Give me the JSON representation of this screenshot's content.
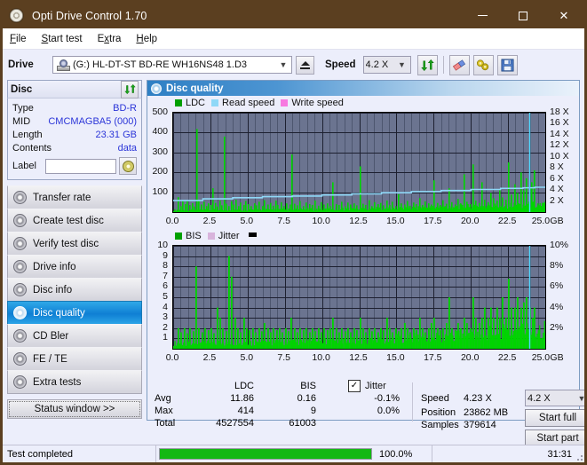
{
  "window": {
    "title": "Opti Drive Control 1.70",
    "icon": "disc-icon",
    "minimize": "─",
    "maximize": "□",
    "close": "✕"
  },
  "menu": {
    "items": [
      {
        "label": "File"
      },
      {
        "label": "Start test"
      },
      {
        "label": "Extra"
      },
      {
        "label": "Help"
      }
    ]
  },
  "toolbar": {
    "drive_label": "Drive",
    "drive_value": "(G:)  HL-DT-ST BD-RE  WH16NS48 1.D3",
    "eject_icon": "eject-icon",
    "speed_label": "Speed",
    "speed_value": "4.2 X",
    "refresh_icon": "refresh-icon",
    "erase_icon": "eraser-icon",
    "tools_icon": "tools-icon",
    "save_icon": "save-icon"
  },
  "disc": {
    "panel_title": "Disc",
    "refresh_icon": "refresh-icon",
    "fields": [
      {
        "key": "Type",
        "value": "BD-R"
      },
      {
        "key": "MID",
        "value": "CMCMAGBA5 (000)"
      },
      {
        "key": "Length",
        "value": "23.31 GB"
      },
      {
        "key": "Contents",
        "value": "data"
      }
    ],
    "label_key": "Label",
    "label_value": "",
    "label_button_icon": "cd-icon"
  },
  "nav": {
    "items": [
      {
        "label": "Transfer rate",
        "selected": false
      },
      {
        "label": "Create test disc",
        "selected": false
      },
      {
        "label": "Verify test disc",
        "selected": false
      },
      {
        "label": "Drive info",
        "selected": false
      },
      {
        "label": "Disc info",
        "selected": false
      },
      {
        "label": "Disc quality",
        "selected": true
      },
      {
        "label": "CD Bler",
        "selected": false
      },
      {
        "label": "FE / TE",
        "selected": false
      },
      {
        "label": "Extra tests",
        "selected": false
      }
    ],
    "status_window": "Status window >>"
  },
  "content": {
    "header_title": "Disc quality",
    "header_icon": "disc-quality-icon"
  },
  "chart_data": [
    {
      "type": "bar",
      "name": "ldc-chart",
      "title": "",
      "xlabel": "GB",
      "ylabel": "LDC",
      "legend": [
        {
          "label": "LDC",
          "color": "#00a000"
        },
        {
          "label": "Read speed",
          "color": "#7ec8f0"
        },
        {
          "label": "Write speed",
          "color": "#f77ae0"
        }
      ],
      "legend_position": "top-left",
      "grid": true,
      "ylim": [
        0,
        500
      ],
      "yticks": [
        100,
        200,
        300,
        400,
        500
      ],
      "y2lim": [
        0,
        18
      ],
      "y2ticks": [
        "2 X",
        "4 X",
        "6 X",
        "8 X",
        "10 X",
        "12 X",
        "14 X",
        "16 X",
        "18 X"
      ],
      "xlim": [
        0,
        25
      ],
      "xticks": [
        "0.0",
        "2.5",
        "5.0",
        "7.5",
        "10.0",
        "12.5",
        "15.0",
        "17.5",
        "20.0",
        "22.5",
        "25.0"
      ],
      "xunit": "GB",
      "bar_color": "#00d400",
      "read_speed_color": "#8fd8f7",
      "spikes": [
        [
          0.28,
          75
        ],
        [
          0.45,
          30
        ],
        [
          0.6,
          55
        ],
        [
          0.75,
          40
        ],
        [
          0.9,
          60
        ],
        [
          1.1,
          35
        ],
        [
          1.25,
          45
        ],
        [
          1.4,
          28
        ],
        [
          1.55,
          418
        ],
        [
          1.7,
          60
        ],
        [
          1.85,
          38
        ],
        [
          2.0,
          52
        ],
        [
          2.2,
          30
        ],
        [
          2.35,
          44
        ],
        [
          2.5,
          36
        ],
        [
          2.65,
          120
        ],
        [
          2.8,
          46
        ],
        [
          2.95,
          28
        ],
        [
          3.1,
          58
        ],
        [
          3.25,
          34
        ],
        [
          3.4,
          380
        ],
        [
          3.55,
          42
        ],
        [
          3.7,
          30
        ],
        [
          3.85,
          55
        ],
        [
          4.0,
          38
        ],
        [
          4.2,
          62
        ],
        [
          4.35,
          30
        ],
        [
          4.5,
          48
        ],
        [
          4.7,
          36
        ],
        [
          4.85,
          56
        ],
        [
          5.0,
          40
        ],
        [
          5.2,
          30
        ],
        [
          5.4,
          44
        ],
        [
          5.55,
          34
        ],
        [
          5.75,
          52
        ],
        [
          5.95,
          30
        ],
        [
          6.1,
          60
        ],
        [
          6.3,
          38
        ],
        [
          6.5,
          46
        ],
        [
          6.7,
          32
        ],
        [
          6.85,
          58
        ],
        [
          7.0,
          36
        ],
        [
          7.2,
          50
        ],
        [
          7.4,
          30
        ],
        [
          7.6,
          44
        ],
        [
          7.8,
          38
        ],
        [
          7.95,
          290
        ],
        [
          8.1,
          42
        ],
        [
          8.3,
          34
        ],
        [
          8.5,
          56
        ],
        [
          8.7,
          30
        ],
        [
          8.9,
          48
        ],
        [
          9.1,
          40
        ],
        [
          9.3,
          36
        ],
        [
          9.5,
          58
        ],
        [
          9.7,
          32
        ],
        [
          9.9,
          50
        ],
        [
          10.1,
          38
        ],
        [
          10.3,
          44
        ],
        [
          10.5,
          30
        ],
        [
          10.7,
          150
        ],
        [
          10.9,
          40
        ],
        [
          11.1,
          36
        ],
        [
          11.3,
          52
        ],
        [
          11.5,
          30
        ],
        [
          11.7,
          48
        ],
        [
          11.9,
          38
        ],
        [
          12.1,
          44
        ],
        [
          12.3,
          34
        ],
        [
          12.5,
          230
        ],
        [
          12.7,
          42
        ],
        [
          12.9,
          36
        ],
        [
          13.1,
          60
        ],
        [
          13.3,
          30
        ],
        [
          13.5,
          50
        ],
        [
          13.7,
          40
        ],
        [
          13.9,
          46
        ],
        [
          14.1,
          34
        ],
        [
          14.3,
          58
        ],
        [
          14.5,
          36
        ],
        [
          14.7,
          52
        ],
        [
          14.9,
          30
        ],
        [
          15.1,
          90
        ],
        [
          15.3,
          44
        ],
        [
          15.5,
          38
        ],
        [
          15.7,
          56
        ],
        [
          15.9,
          32
        ],
        [
          16.1,
          48
        ],
        [
          16.3,
          40
        ],
        [
          16.5,
          70
        ],
        [
          16.7,
          36
        ],
        [
          16.9,
          54
        ],
        [
          17.1,
          44
        ],
        [
          17.3,
          38
        ],
        [
          17.5,
          160
        ],
        [
          17.7,
          46
        ],
        [
          17.9,
          36
        ],
        [
          18.1,
          60
        ],
        [
          18.3,
          42
        ],
        [
          18.5,
          120
        ],
        [
          18.7,
          50
        ],
        [
          18.9,
          38
        ],
        [
          19.1,
          66
        ],
        [
          19.3,
          44
        ],
        [
          19.5,
          190
        ],
        [
          19.7,
          52
        ],
        [
          19.9,
          40
        ],
        [
          20.1,
          240
        ],
        [
          20.3,
          58
        ],
        [
          20.5,
          46
        ],
        [
          20.7,
          150
        ],
        [
          20.9,
          62
        ],
        [
          21.1,
          50
        ],
        [
          21.3,
          96
        ],
        [
          21.5,
          70
        ],
        [
          21.7,
          58
        ],
        [
          21.9,
          110
        ],
        [
          22.1,
          74
        ],
        [
          22.3,
          62
        ],
        [
          22.5,
          250
        ],
        [
          22.7,
          88
        ],
        [
          22.9,
          140
        ],
        [
          23.1,
          96
        ],
        [
          23.3,
          200
        ],
        [
          23.5,
          110
        ],
        [
          23.7,
          170
        ],
        [
          23.9,
          125
        ],
        [
          24.05,
          150
        ],
        [
          24.2,
          210
        ]
      ],
      "baseline": 22,
      "read_speed_steps": [
        [
          0.0,
          2.1
        ],
        [
          2.0,
          2.4
        ],
        [
          4.0,
          2.6
        ],
        [
          6.0,
          2.8
        ],
        [
          8.0,
          2.9
        ],
        [
          10.0,
          3.1
        ],
        [
          12.0,
          3.3
        ],
        [
          14.0,
          3.5
        ],
        [
          16.0,
          3.7
        ],
        [
          18.0,
          3.9
        ],
        [
          20.0,
          4.1
        ],
        [
          22.0,
          4.3
        ],
        [
          23.5,
          4.4
        ],
        [
          24.3,
          4.5
        ]
      ],
      "cursor_x": 23.9
    },
    {
      "type": "bar",
      "name": "bis-chart",
      "title": "",
      "xlabel": "GB",
      "ylabel": "BIS",
      "legend": [
        {
          "label": "BIS",
          "color": "#00a000"
        },
        {
          "label": "Jitter",
          "color": "#d8b4dc"
        }
      ],
      "legend_position": "top-left",
      "grid": true,
      "ylim": [
        0,
        10
      ],
      "yticks": [
        1,
        2,
        3,
        4,
        5,
        6,
        7,
        8,
        9,
        10
      ],
      "y2lim": [
        0,
        10
      ],
      "y2ticks": [
        "2%",
        "4%",
        "6%",
        "8%",
        "10%"
      ],
      "xlim": [
        0,
        25
      ],
      "xticks": [
        "0.0",
        "2.5",
        "5.0",
        "7.5",
        "10.0",
        "12.5",
        "15.0",
        "17.5",
        "20.0",
        "22.5",
        "25.0"
      ],
      "xunit": "GB",
      "bar_color": "#00d400",
      "baseline": 1.1,
      "spikes": [
        [
          0.3,
          2
        ],
        [
          0.5,
          1.6
        ],
        [
          0.7,
          2
        ],
        [
          0.9,
          1.5
        ],
        [
          1.1,
          2
        ],
        [
          1.3,
          1.7
        ],
        [
          1.5,
          8
        ],
        [
          1.7,
          2
        ],
        [
          1.9,
          1.6
        ],
        [
          2.1,
          2
        ],
        [
          2.3,
          1.8
        ],
        [
          2.5,
          2
        ],
        [
          2.7,
          1.5
        ],
        [
          2.9,
          4
        ],
        [
          3.1,
          3
        ],
        [
          3.3,
          2
        ],
        [
          3.5,
          1.7
        ],
        [
          3.7,
          9
        ],
        [
          3.9,
          7
        ],
        [
          4.1,
          3
        ],
        [
          4.3,
          2
        ],
        [
          4.5,
          1.6
        ],
        [
          4.7,
          3
        ],
        [
          4.9,
          2
        ],
        [
          5.1,
          1.8
        ],
        [
          5.3,
          2
        ],
        [
          5.5,
          1.6
        ],
        [
          5.7,
          2
        ],
        [
          5.9,
          1.7
        ],
        [
          6.1,
          2.5
        ],
        [
          6.3,
          2
        ],
        [
          6.5,
          1.6
        ],
        [
          6.7,
          2
        ],
        [
          6.9,
          1.8
        ],
        [
          7.1,
          2
        ],
        [
          7.3,
          1.6
        ],
        [
          7.5,
          2
        ],
        [
          7.7,
          1.7
        ],
        [
          7.9,
          3
        ],
        [
          8.1,
          2
        ],
        [
          8.3,
          1.6
        ],
        [
          8.5,
          2
        ],
        [
          8.7,
          1.8
        ],
        [
          8.9,
          2
        ],
        [
          9.1,
          1.6
        ],
        [
          9.3,
          2
        ],
        [
          9.5,
          1.7
        ],
        [
          9.7,
          2
        ],
        [
          9.9,
          1.6
        ],
        [
          10.1,
          2
        ],
        [
          10.3,
          1.8
        ],
        [
          10.5,
          2
        ],
        [
          10.7,
          3
        ],
        [
          10.9,
          2
        ],
        [
          11.1,
          1.6
        ],
        [
          11.3,
          2
        ],
        [
          11.5,
          1.7
        ],
        [
          11.7,
          2
        ],
        [
          11.9,
          1.6
        ],
        [
          12.1,
          2
        ],
        [
          12.3,
          1.8
        ],
        [
          12.5,
          3
        ],
        [
          12.7,
          2
        ],
        [
          12.9,
          1.6
        ],
        [
          13.1,
          2
        ],
        [
          13.3,
          1.7
        ],
        [
          13.5,
          2
        ],
        [
          13.7,
          1.6
        ],
        [
          13.9,
          2
        ],
        [
          14.1,
          1.8
        ],
        [
          14.3,
          3
        ],
        [
          14.5,
          2
        ],
        [
          14.7,
          1.6
        ],
        [
          14.9,
          2
        ],
        [
          15.1,
          1.7
        ],
        [
          15.3,
          2
        ],
        [
          15.5,
          2.5
        ],
        [
          15.7,
          2
        ],
        [
          15.9,
          1.6
        ],
        [
          16.1,
          2
        ],
        [
          16.3,
          1.8
        ],
        [
          16.5,
          3
        ],
        [
          16.7,
          2
        ],
        [
          16.9,
          1.6
        ],
        [
          17.1,
          2
        ],
        [
          17.3,
          2.5
        ],
        [
          17.5,
          3
        ],
        [
          17.7,
          2
        ],
        [
          17.9,
          1.8
        ],
        [
          18.1,
          2
        ],
        [
          18.3,
          2.5
        ],
        [
          18.5,
          5
        ],
        [
          18.7,
          2
        ],
        [
          18.9,
          1.8
        ],
        [
          19.1,
          2.5
        ],
        [
          19.3,
          2
        ],
        [
          19.5,
          3
        ],
        [
          19.7,
          2.5
        ],
        [
          19.9,
          2
        ],
        [
          20.1,
          5
        ],
        [
          20.3,
          3
        ],
        [
          20.5,
          2.5
        ],
        [
          20.7,
          3
        ],
        [
          20.9,
          4
        ],
        [
          21.1,
          3
        ],
        [
          21.3,
          4
        ],
        [
          21.5,
          3
        ],
        [
          21.7,
          4
        ],
        [
          21.9,
          3
        ],
        [
          22.1,
          5
        ],
        [
          22.3,
          3
        ],
        [
          22.5,
          6.8
        ],
        [
          22.7,
          4
        ],
        [
          22.9,
          4
        ],
        [
          23.1,
          5
        ],
        [
          23.3,
          4
        ],
        [
          23.5,
          4.5
        ],
        [
          23.7,
          5
        ],
        [
          23.9,
          4
        ],
        [
          24.1,
          3
        ],
        [
          24.25,
          4
        ]
      ],
      "cursor_x": 23.9
    }
  ],
  "stats": {
    "columns": [
      "LDC",
      "BIS"
    ],
    "jitter_label": "Jitter",
    "jitter_checked": true,
    "rows": [
      {
        "label": "Avg",
        "ldc": "11.86",
        "bis": "0.16",
        "jitter": "-0.1%"
      },
      {
        "label": "Max",
        "ldc": "414",
        "bis": "9",
        "jitter": "0.0%"
      },
      {
        "label": "Total",
        "ldc": "4527554",
        "bis": "61003",
        "jitter": ""
      }
    ]
  },
  "readout": {
    "speed_label": "Speed",
    "speed_value": "4.23 X",
    "position_label": "Position",
    "position_value": "23862 MB",
    "samples_label": "Samples",
    "samples_value": "379614",
    "speed_select": "4.2 X",
    "start_full": "Start full",
    "start_part": "Start part"
  },
  "statusbar": {
    "message": "Test completed",
    "progress_percent": 100.0,
    "progress_text": "100.0%",
    "elapsed": "31:31"
  }
}
